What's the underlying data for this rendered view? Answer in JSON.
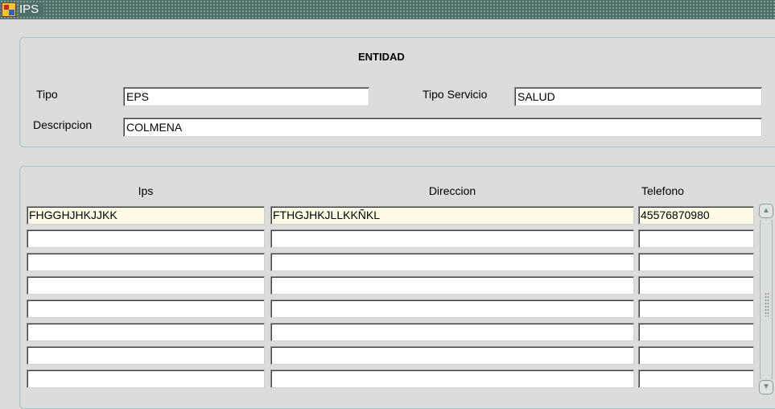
{
  "window": {
    "title": "IPS",
    "icon": "oracle-forms-app-icon"
  },
  "entidad": {
    "heading": "ENTIDAD",
    "tipo": {
      "label": "Tipo",
      "value": "EPS"
    },
    "tipo_servicio": {
      "label": "Tipo Servicio",
      "value": "SALUD"
    },
    "descripcion": {
      "label": "Descripcion",
      "value": "COLMENA"
    }
  },
  "table": {
    "columns": [
      "Ips",
      "Direccion",
      "Telefono"
    ],
    "rows": [
      [
        "FHGGHJHKJJKK",
        "FTHGJHKJLLKKÑKL",
        "45576870980"
      ],
      [
        "",
        "",
        ""
      ],
      [
        "",
        "",
        ""
      ],
      [
        "",
        "",
        ""
      ],
      [
        "",
        "",
        ""
      ],
      [
        "",
        "",
        ""
      ],
      [
        "",
        "",
        ""
      ],
      [
        "",
        "",
        ""
      ]
    ],
    "scroll_up_icon": "chevron-up-icon",
    "scroll_down_icon": "chevron-down-icon"
  }
}
